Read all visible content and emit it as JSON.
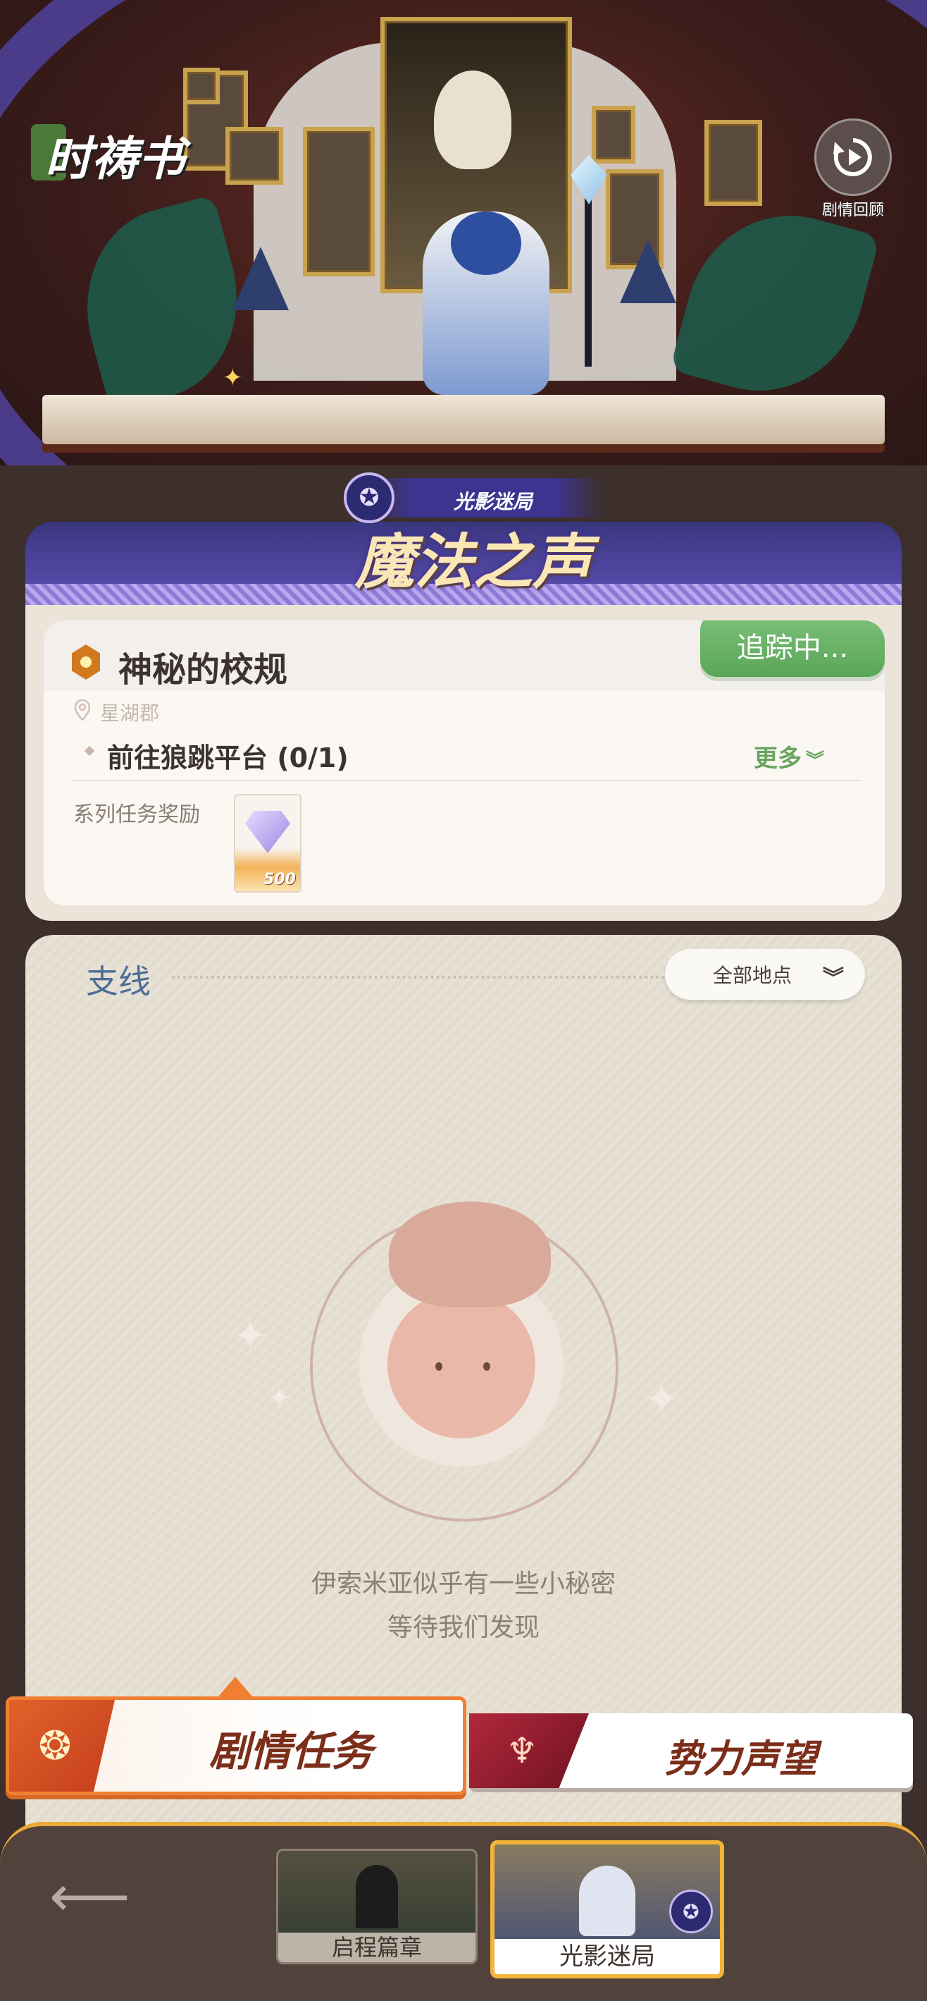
{
  "header": {
    "book_title": "时祷书",
    "replay_label": "剧情回顾"
  },
  "banner": {
    "subtitle": "光影迷局",
    "title": "魔法之声"
  },
  "main_quest": {
    "title": "神秘的校规",
    "tracking_label": "追踪中...",
    "location": "星湖郡",
    "step": "前往狼跳平台 (0/1)",
    "more_label": "更多",
    "reward_label": "系列任务奖励",
    "reward_amount": "500"
  },
  "side_quests": {
    "title": "支线",
    "filter_label": "全部地点",
    "empty_message_line1": "伊索米亚似乎有一些小秘密",
    "empty_message_line2": "等待我们发现"
  },
  "tabs": {
    "story_label": "剧情任务",
    "faction_label": "势力声望"
  },
  "chapters": [
    {
      "label": "启程篇章"
    },
    {
      "label": "光影迷局"
    }
  ],
  "colors": {
    "tracking_green": "#5aa658",
    "accent_orange": "#f07f32",
    "side_title_blue": "#4c6e96",
    "chapter_selected": "#f3b43a"
  }
}
